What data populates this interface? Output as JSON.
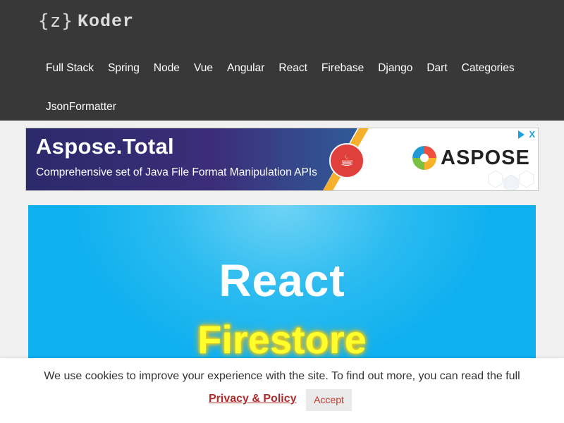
{
  "header": {
    "logo": {
      "brace": "{z}",
      "name": "Koder"
    },
    "nav_row1": [
      "Full Stack",
      "Spring",
      "Node",
      "Vue",
      "Angular",
      "React",
      "Firebase",
      "Django",
      "Dart",
      "Categories"
    ],
    "nav_row2": [
      "JsonFormatter"
    ]
  },
  "ad": {
    "title": "Aspose.Total",
    "subtitle": "Comprehensive set of Java File Format Manipulation APIs",
    "brand": "ASPOSE",
    "icon": "java-cup-icon",
    "choices_icon": "adchoices-icon",
    "close_label": "X"
  },
  "hero": {
    "title": "React",
    "subtitle": "Firestore"
  },
  "cookie": {
    "text": "We use cookies to improve your experience with the site. To find out more, you can read the full",
    "link_label": "Privacy & Policy",
    "accept_label": "Accept"
  },
  "colors": {
    "header_bg": "#383838",
    "hero_blue": "#0fb0ef",
    "hero_subtitle": "#ffff2e",
    "link_red": "#b02a2a"
  }
}
